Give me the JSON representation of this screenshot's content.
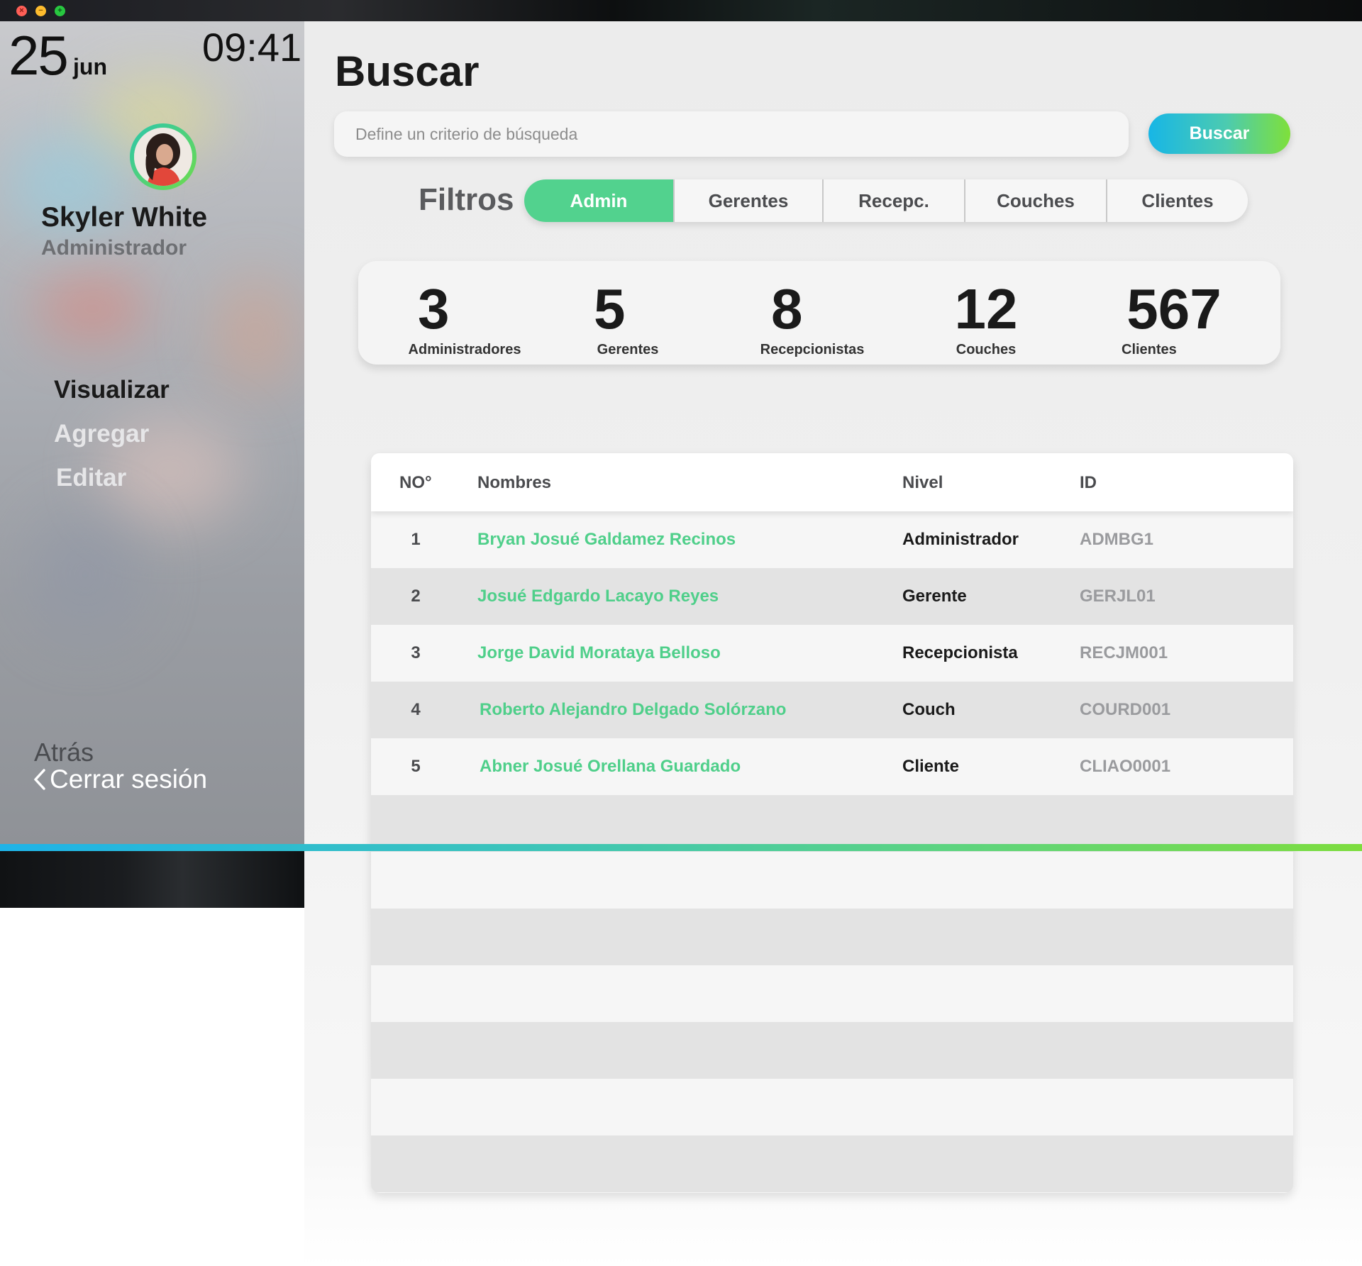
{
  "window": {
    "close": "×",
    "minimize": "−",
    "maximize": "+"
  },
  "sidebar": {
    "date_day": "25",
    "date_month": "jun",
    "time": "09:41",
    "user": {
      "name": "Skyler White",
      "role": "Administrador"
    },
    "nav": [
      {
        "label": "Visualizar",
        "active": true
      },
      {
        "label": "Agregar",
        "active": false
      },
      {
        "label": "Editar",
        "active": false
      }
    ],
    "back_label": "Atrás",
    "logout_label": "Cerrar sesión"
  },
  "main": {
    "title": "Buscar",
    "search": {
      "placeholder": "Define un criterio de búsqueda",
      "button_label": "Buscar"
    },
    "filters": {
      "label": "Filtros",
      "tabs": [
        "Admin",
        "Gerentes",
        "Recepc.",
        "Couches",
        "Clientes"
      ],
      "active_index": 0
    },
    "stats": [
      {
        "value": "3",
        "label": "Administradores"
      },
      {
        "value": "5",
        "label": "Gerentes"
      },
      {
        "value": "8",
        "label": "Recepcionistas"
      },
      {
        "value": "12",
        "label": "Couches"
      },
      {
        "value": "567",
        "label": "Clientes"
      }
    ],
    "table": {
      "headers": [
        "NO°",
        "Nombres",
        "Nivel",
        "ID"
      ],
      "rows": [
        {
          "no": "1",
          "name": "Bryan Josué Galdamez Recinos",
          "level": "Administrador",
          "id": "ADMBG1"
        },
        {
          "no": "2",
          "name": "Josué Edgardo Lacayo Reyes",
          "level": "Gerente",
          "id": "GERJL01"
        },
        {
          "no": "3",
          "name": "Jorge David Morataya Belloso",
          "level": "Recepcionista",
          "id": "RECJM001"
        },
        {
          "no": "4",
          "name": "Roberto Alejandro Delgado Solórzano",
          "level": "Couch",
          "id": "COURD001"
        },
        {
          "no": "5",
          "name": "Abner Josué Orellana Guardado",
          "level": "Cliente",
          "id": "CLIAO0001"
        }
      ]
    }
  },
  "colors": {
    "accent_green": "#52d28e",
    "name_green": "#4fcf8a",
    "gradient_start": "#1fb3e8",
    "gradient_end": "#7ddd3e"
  }
}
